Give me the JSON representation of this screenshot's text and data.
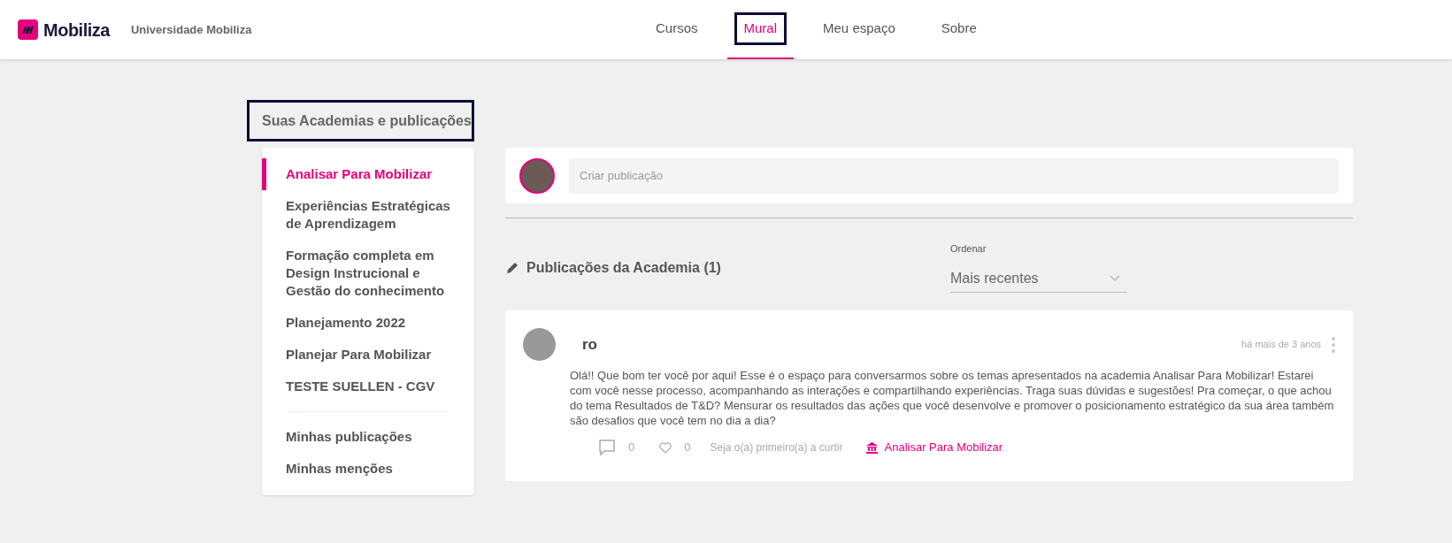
{
  "header": {
    "brand": "Mobiliza",
    "organization": "Universidade Mobiliza",
    "nav": [
      {
        "label": "Cursos",
        "selected": false
      },
      {
        "label": "Mural",
        "selected": true
      },
      {
        "label": "Meu espaço",
        "selected": false
      },
      {
        "label": "Sobre",
        "selected": false
      }
    ]
  },
  "sidebar": {
    "title": "Suas Academias e publicações",
    "academies": [
      {
        "label": "Analisar Para Mobilizar",
        "selected": true
      },
      {
        "label": "Experiências Estratégicas de Aprendizagem",
        "selected": false
      },
      {
        "label": "Formação completa em Design Instrucional e Gestão do conhecimento",
        "selected": false
      },
      {
        "label": "Planejamento 2022",
        "selected": false
      },
      {
        "label": "Planejar Para Mobilizar",
        "selected": false
      },
      {
        "label": "TESTE SUELLEN - CGV",
        "selected": false
      }
    ],
    "personal": [
      {
        "label": "Minhas publicações",
        "selected": false
      },
      {
        "label": "Minhas menções",
        "selected": false
      }
    ]
  },
  "composer": {
    "placeholder": "Criar publicação"
  },
  "feed": {
    "title": "Publicações da Academia (1)",
    "sort_label": "Ordenar",
    "sort_value": "Mais recentes"
  },
  "posts": [
    {
      "author": "ro",
      "time": "há mais de 3 anos",
      "body": "Olá!! Que bom ter você por aqui! Esse é o espaço para conversarmos sobre os temas apresentados na academia Analisar Para Mobilizar! Estarei com você nesse processo, acompanhando as interações e compartilhando experiências. Traga suas dúvidas e sugestões! Pra começar, o que achou do tema Resultados de T&D? Mensurar os resultados das ações que você desenvolve e promover o posicionamento estratégico da sua área também são desafios que você tem no dia a dia?",
      "comments": "0",
      "likes": "0",
      "like_prompt": "Seja o(a) primeiro(a) a curtir",
      "academy": "Analisar Para Mobilizar"
    }
  ]
}
